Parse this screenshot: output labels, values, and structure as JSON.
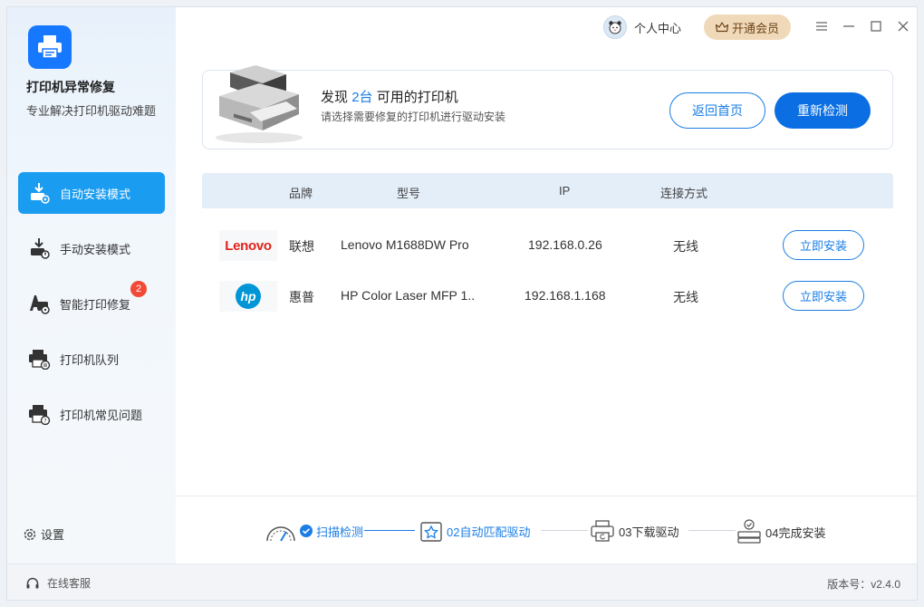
{
  "app": {
    "name": "打印机异常修复",
    "subtitle": "专业解决打印机驱动难题",
    "accent": "#1a9cf0",
    "primary_button": "#0b6fe3"
  },
  "topbar": {
    "user_center": "个人中心",
    "vip": "开通会员",
    "controls": [
      "menu-icon",
      "minimize-icon",
      "maximize-icon",
      "close-icon"
    ]
  },
  "sidebar": {
    "items": [
      {
        "label": "自动安装模式",
        "icon": "auto-install-icon",
        "active": true
      },
      {
        "label": "手动安装模式",
        "icon": "manual-install-icon",
        "active": false
      },
      {
        "label": "智能打印修复",
        "icon": "smart-repair-icon",
        "active": false,
        "badge": "2"
      },
      {
        "label": "打印机队列",
        "icon": "printer-queue-icon",
        "active": false
      },
      {
        "label": "打印机常见问题",
        "icon": "printer-faq-icon",
        "active": false
      }
    ],
    "settings": "设置"
  },
  "banner": {
    "found_prefix": "发现",
    "found_count": "2台",
    "found_suffix": "可用的打印机",
    "subtitle": "请选择需要修复的打印机进行驱动安装",
    "back_button": "返回首页",
    "rescan_button": "重新检测"
  },
  "table": {
    "headers": {
      "brand": "品牌",
      "model": "型号",
      "ip": "IP",
      "connection": "连接方式"
    },
    "rows": [
      {
        "logo": "Lenovo",
        "brand": "联想",
        "model": "Lenovo M1688DW Pro",
        "ip": "192.168.0.26",
        "connection": "无线",
        "action": "立即安装"
      },
      {
        "logo": "hp",
        "brand": "惠普",
        "model": "HP Color Laser MFP 1..",
        "ip": "192.168.1.168",
        "connection": "无线",
        "action": "立即安装"
      }
    ]
  },
  "steps": [
    {
      "label": "扫描检测",
      "status": "done"
    },
    {
      "label": "02自动匹配驱动",
      "status": "current"
    },
    {
      "label": "03下载驱动",
      "status": "pending"
    },
    {
      "label": "04完成安装",
      "status": "pending"
    }
  ],
  "footer": {
    "support": "在线客服",
    "version": "版本号：v2.4.0"
  }
}
